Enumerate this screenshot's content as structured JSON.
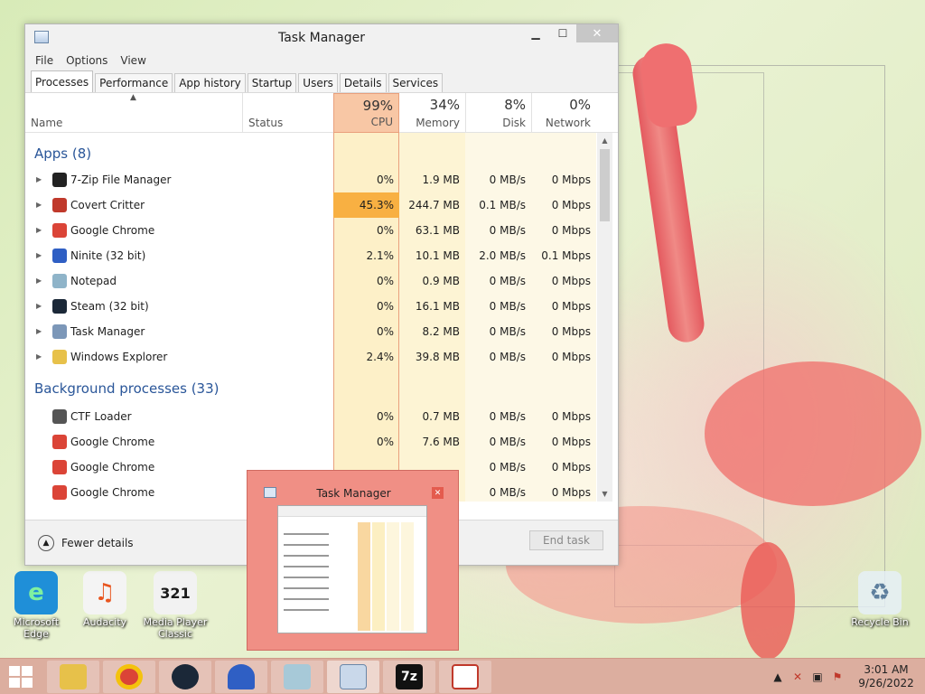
{
  "desktop": {
    "icons": [
      {
        "id": "edge",
        "label_line1": "Microsoft",
        "label_line2": "Edge",
        "color": "#1f8fd8",
        "glyph": "e"
      },
      {
        "id": "audacity",
        "label_line1": "Audacity",
        "label_line2": "",
        "color": "#e8551f",
        "glyph": "♫"
      },
      {
        "id": "mpc",
        "label_line1": "Media Player",
        "label_line2": "Classic",
        "color": "#2b2b2b",
        "glyph": "321"
      },
      {
        "id": "recycle",
        "label_line1": "Recycle Bin",
        "label_line2": "",
        "color": "#9fb5c9",
        "glyph": "♻"
      }
    ]
  },
  "window": {
    "title": "Task Manager",
    "menu": [
      "File",
      "Options",
      "View"
    ],
    "tabs": [
      "Processes",
      "Performance",
      "App history",
      "Startup",
      "Users",
      "Details",
      "Services"
    ],
    "active_tab": "Processes"
  },
  "columns": {
    "name": "Name",
    "status": "Status",
    "cpu": {
      "pct": "99%",
      "label": "CPU"
    },
    "memory": {
      "pct": "34%",
      "label": "Memory"
    },
    "disk": {
      "pct": "8%",
      "label": "Disk"
    },
    "network": {
      "pct": "0%",
      "label": "Network"
    }
  },
  "groups": {
    "apps": "Apps (8)",
    "background": "Background processes (33)"
  },
  "rows": [
    {
      "name": "7-Zip File Manager",
      "cpu": "0%",
      "mem": "1.9 MB",
      "disk": "0 MB/s",
      "net": "0 Mbps",
      "icon": "#222222",
      "expand": true
    },
    {
      "name": "Covert Critter",
      "cpu": "45.3%",
      "mem": "244.7 MB",
      "disk": "0.1 MB/s",
      "net": "0 Mbps",
      "icon": "#c0392b",
      "expand": true
    },
    {
      "name": "Google Chrome",
      "cpu": "0%",
      "mem": "63.1 MB",
      "disk": "0 MB/s",
      "net": "0 Mbps",
      "icon": "#db4437",
      "expand": true
    },
    {
      "name": "Ninite (32 bit)",
      "cpu": "2.1%",
      "mem": "10.1 MB",
      "disk": "2.0 MB/s",
      "net": "0.1 Mbps",
      "icon": "#2f5fc4",
      "expand": true
    },
    {
      "name": "Notepad",
      "cpu": "0%",
      "mem": "0.9 MB",
      "disk": "0 MB/s",
      "net": "0 Mbps",
      "icon": "#8fb4c9",
      "expand": true
    },
    {
      "name": "Steam (32 bit)",
      "cpu": "0%",
      "mem": "16.1 MB",
      "disk": "0 MB/s",
      "net": "0 Mbps",
      "icon": "#1b2838",
      "expand": true
    },
    {
      "name": "Task Manager",
      "cpu": "0%",
      "mem": "8.2 MB",
      "disk": "0 MB/s",
      "net": "0 Mbps",
      "icon": "#7c97b8",
      "expand": true
    },
    {
      "name": "Windows Explorer",
      "cpu": "2.4%",
      "mem": "39.8 MB",
      "disk": "0 MB/s",
      "net": "0 Mbps",
      "icon": "#e7c14a",
      "expand": true
    }
  ],
  "bg_rows": [
    {
      "name": "CTF Loader",
      "cpu": "0%",
      "mem": "0.7 MB",
      "disk": "0 MB/s",
      "net": "0 Mbps",
      "icon": "#555555"
    },
    {
      "name": "Google Chrome",
      "cpu": "0%",
      "mem": "7.6 MB",
      "disk": "0 MB/s",
      "net": "0 Mbps",
      "icon": "#db4437"
    },
    {
      "name": "Google Chrome",
      "cpu": "",
      "mem": "",
      "disk": "0 MB/s",
      "net": "0 Mbps",
      "icon": "#db4437"
    },
    {
      "name": "Google Chrome",
      "cpu": "",
      "mem": "",
      "disk": "0 MB/s",
      "net": "0 Mbps",
      "icon": "#db4437"
    }
  ],
  "footer": {
    "fewer_details": "Fewer details",
    "end_task": "End task"
  },
  "preview": {
    "title": "Task Manager"
  },
  "tray": {
    "time": "3:01 AM",
    "date": "9/26/2022"
  },
  "colors": {
    "cpu_hot": "#f8b042",
    "cpu_col": "#fdf0c8",
    "mem_col": "#fdf5d6",
    "accent_group": "#2a5699"
  }
}
